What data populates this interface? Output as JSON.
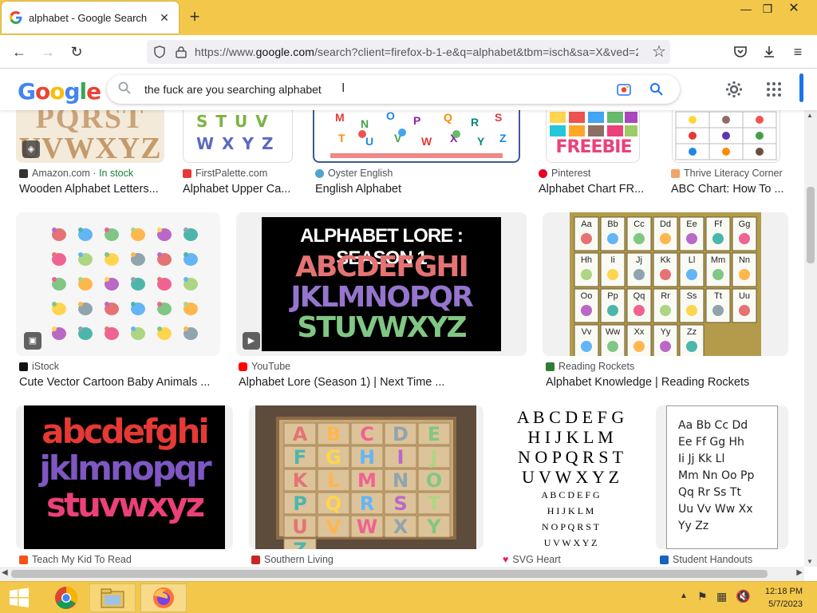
{
  "browser": {
    "tab_title": "alphabet - Google Search",
    "url_prefix": "https://www.",
    "url_domain": "google.com",
    "url_rest": "/search?client=firefox-b-1-e&q=alphabet&tbm=isch&sa=X&ved=2"
  },
  "search": {
    "query": "the fuck are you searching alphabet"
  },
  "logo_text": [
    "G",
    "o",
    "o",
    "g",
    "l",
    "e"
  ],
  "colors": {
    "accent": "#1a73e8",
    "titlebar": "#f3c84a"
  },
  "results": {
    "row1": [
      {
        "source": "Amazon.com",
        "stock": "In stock",
        "title": "Wooden Alphabet Letters..."
      },
      {
        "source": "FirstPalette.com",
        "title": "Alphabet Upper Ca..."
      },
      {
        "source": "Oyster English",
        "title": "English Alphabet"
      },
      {
        "source": "Pinterest",
        "title": "Alphabet Chart FR..."
      },
      {
        "source": "Thrive Literacy Corner",
        "title": "ABC Chart: How To ..."
      }
    ],
    "row2": [
      {
        "source": "iStock",
        "title": "Cute Vector Cartoon Baby Animals ..."
      },
      {
        "source": "YouTube",
        "title": "Alphabet Lore (Season 1) | Next Time ..."
      },
      {
        "source": "Reading Rockets",
        "title": "Alphabet Knowledge | Reading Rockets"
      }
    ],
    "row3": [
      {
        "source": "Teach My Kid To Read"
      },
      {
        "source": "Southern Living"
      },
      {
        "source": "SVG Heart"
      },
      {
        "source": "Student Handouts"
      }
    ]
  },
  "images": {
    "wood_top": "PQRST",
    "wood_bottom": "UVWXYZ",
    "upper_row": "STUV",
    "upper_row2": "WXYZ",
    "freebie": "FREEBIE",
    "lore_title": "ALPHABET LORE : SEASON 1",
    "lore_rows": [
      "ABCDEFGHI",
      "JKLMNOPQR",
      "STUVWXYZ"
    ],
    "colorful_rows": [
      "abcdefghi",
      "jklmnopqr",
      "stuvwxyz"
    ],
    "serif_rows_big": [
      "A B C D E F G",
      "H I J K L M",
      "N O P Q R S T",
      "U V W X Y Z"
    ],
    "serif_rows_small": [
      "A B C D E F G",
      "H I J K L M",
      "N O P Q R S T",
      "U V W X Y Z"
    ],
    "handout_rows": [
      "Aa Bb Cc Dd",
      "Ee Ff Gg Hh",
      "Ii Jj Kk Ll",
      "Mm Nn Oo Pp",
      "Qq Rr Ss Tt",
      "Uu Vv Ww Xx",
      "Yy Zz"
    ],
    "rockets_cells": [
      "Aa",
      "Bb",
      "Cc",
      "Dd",
      "Ee",
      "Ff",
      "Gg",
      "Hh",
      "Ii",
      "Jj",
      "Kk",
      "Ll",
      "Mm",
      "Nn",
      "Oo",
      "Pp",
      "Qq",
      "Rr",
      "Ss",
      "Tt",
      "Uu",
      "Vv",
      "Ww",
      "Xx",
      "Yy",
      "Zz"
    ],
    "tray_letters": [
      "A",
      "B",
      "C",
      "D",
      "E",
      "F",
      "G",
      "H",
      "I",
      "J",
      "K",
      "L",
      "M",
      "N",
      "O",
      "P",
      "Q",
      "R",
      "S",
      "T",
      "U",
      "V",
      "W",
      "X",
      "Y",
      "Z"
    ]
  },
  "taskbar": {
    "time": "12:18 PM",
    "date": "5/7/2023"
  }
}
